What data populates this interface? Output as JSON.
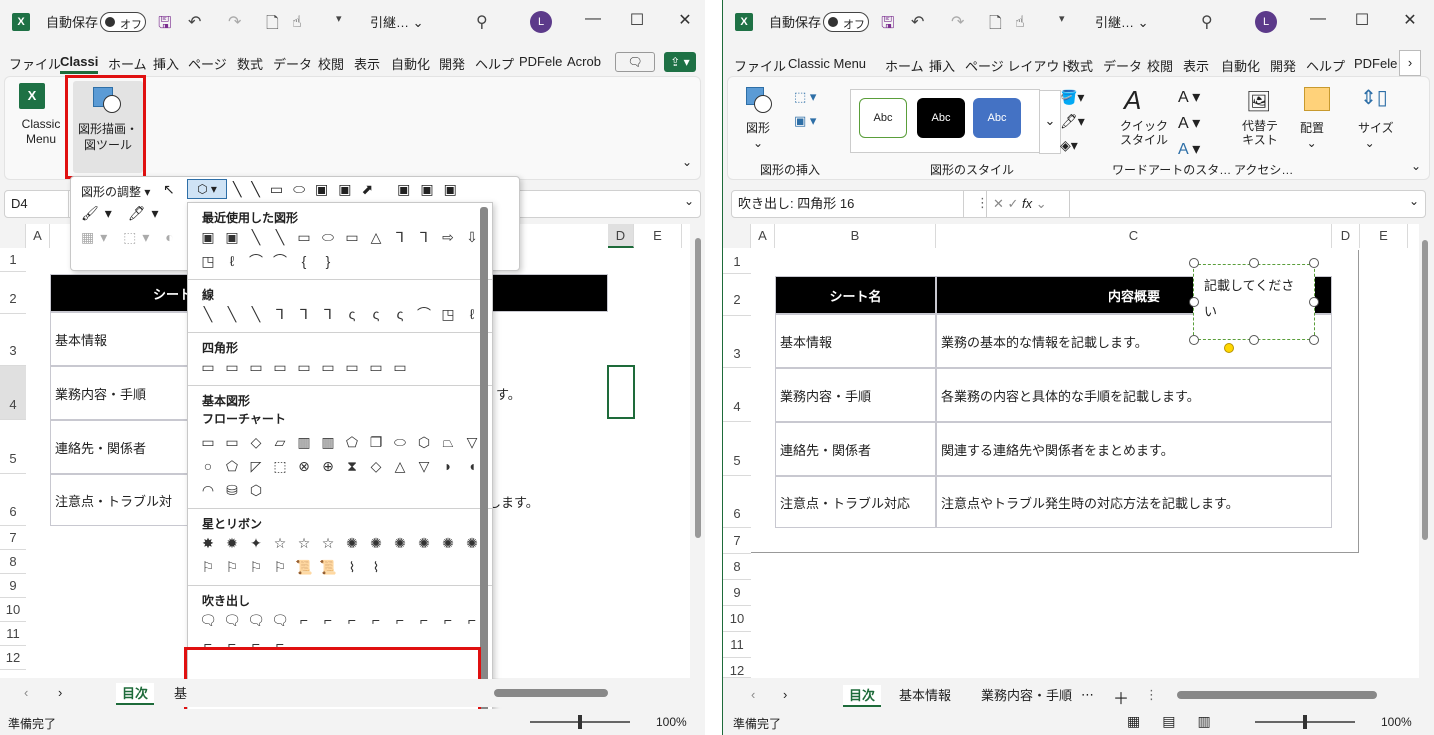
{
  "left": {
    "title": {
      "autosave": "自動保存",
      "toggle": "オフ",
      "filename": "引継…",
      "avatar": "L"
    },
    "tabs": [
      "ファイル",
      "Classi",
      "ホーム",
      "挿入",
      "ページ",
      "数式",
      "データ",
      "校閲",
      "表示",
      "自動化",
      "開発",
      "ヘルプ",
      "PDFele",
      "Acrob"
    ],
    "ribbon": {
      "classic_menu": "Classic Menu",
      "shape_tool": "図形描画・図ツール"
    },
    "namebox": "D4",
    "toolbar": {
      "adjust": "図形の調整"
    },
    "columns": [
      "A",
      "D",
      "E"
    ],
    "rows": [
      "1",
      "2",
      "3",
      "4",
      "5",
      "6",
      "7",
      "8",
      "9",
      "10",
      "11",
      "12"
    ],
    "table": {
      "header": "シート名",
      "rows": [
        "基本情報",
        "業務内容・手順",
        "連絡先・関係者",
        "注意点・トラブル対"
      ],
      "fragments": [
        "す。",
        "します。"
      ]
    },
    "menu": {
      "recent": "最近使用した図形",
      "lines": "線",
      "rect": "四角形",
      "basic": "基本図形",
      "flow": "フローチャート",
      "stars": "星とリボン",
      "callouts": "吹き出し"
    },
    "sheet_tabs": [
      "目次",
      "基"
    ],
    "status": {
      "ready": "準備完了",
      "zoom": "100%"
    }
  },
  "right": {
    "title": {
      "autosave": "自動保存",
      "toggle": "オフ",
      "filename": "引継…",
      "avatar": "L"
    },
    "tabs": [
      "ファイル",
      "Classic Menu",
      "ホーム",
      "挿入",
      "ページ レイアウト",
      "数式",
      "データ",
      "校閲",
      "表示",
      "自動化",
      "開発",
      "ヘルプ",
      "PDFele"
    ],
    "ribbon": {
      "shape": "図形",
      "insert_group": "図形の挿入",
      "style_group": "図形のスタイル",
      "abc": "Abc",
      "quick_style": "クイック スタイル",
      "wordart_group": "ワードアートのスタ…",
      "alt_text": "代替テキスト",
      "access_group": "アクセシ…",
      "arrange": "配置",
      "size": "サイズ"
    },
    "namebox": "吹き出し: 四角形 16",
    "fx": "fx",
    "columns": [
      "A",
      "B",
      "C",
      "D",
      "E"
    ],
    "rows": [
      "1",
      "2",
      "3",
      "4",
      "5",
      "6",
      "7",
      "8",
      "9",
      "10",
      "11",
      "12"
    ],
    "table": {
      "headers": [
        "シート名",
        "内容概要"
      ],
      "rows": [
        [
          "基本情報",
          "業務の基本的な情報を記載します。"
        ],
        [
          "業務内容・手順",
          "各業務の内容と具体的な手順を記載します。"
        ],
        [
          "連絡先・関係者",
          "関連する連絡先や関係者をまとめます。"
        ],
        [
          "注意点・トラブル対応",
          "注意点やトラブル発生時の対応方法を記載します。"
        ]
      ]
    },
    "callout_text": "記載してください",
    "sheet_tabs": [
      "目次",
      "基本情報",
      "業務内容・手順"
    ],
    "status": {
      "ready": "準備完了",
      "zoom": "100%"
    }
  }
}
